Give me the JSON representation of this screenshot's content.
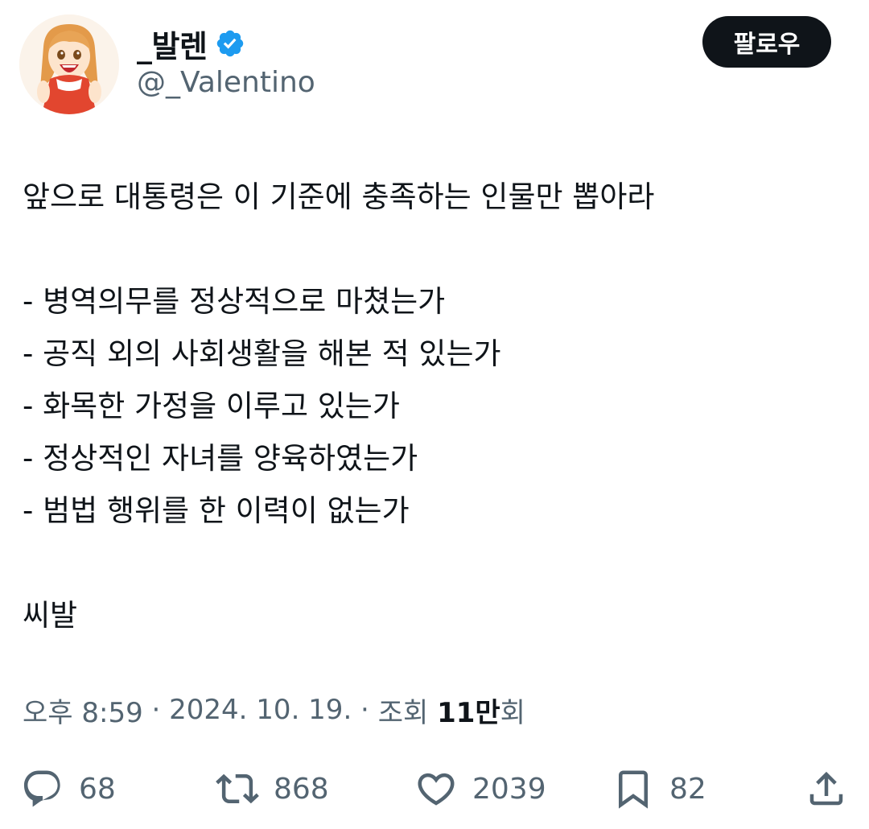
{
  "author": {
    "display_name": "_발렌",
    "handle": "@_Valentino",
    "verified": true,
    "avatar_icon": "cartoon-girl-avatar"
  },
  "follow_button": {
    "label": "팔로우"
  },
  "tweet": {
    "lines": [
      "앞으로 대통령은 이 기준에 충족하는 인물만 뽑아라",
      "",
      "- 병역의무를 정상적으로 마쳤는가",
      "- 공직 외의 사회생활을 해본 적 있는가",
      "- 화목한 가정을 이루고 있는가",
      "- 정상적인 자녀를 양육하였는가",
      "- 범법 행위를 한 이력이 없는가",
      "",
      "씨발"
    ]
  },
  "meta": {
    "time": "오후 8:59",
    "separator": " · ",
    "date": "2024. 10. 19.",
    "views_label": "조회 ",
    "views_count": "11만",
    "views_suffix": "회"
  },
  "actions": {
    "reply": {
      "icon": "reply-icon",
      "count": "68"
    },
    "retweet": {
      "icon": "retweet-icon",
      "count": "868"
    },
    "like": {
      "icon": "heart-icon",
      "count": "2039"
    },
    "bookmark": {
      "icon": "bookmark-icon",
      "count": "82"
    },
    "share": {
      "icon": "share-icon"
    }
  },
  "colors": {
    "text_primary": "#0f1419",
    "text_secondary": "#536471",
    "verified_blue": "#1d9bf0",
    "button_bg": "#0f1419"
  }
}
